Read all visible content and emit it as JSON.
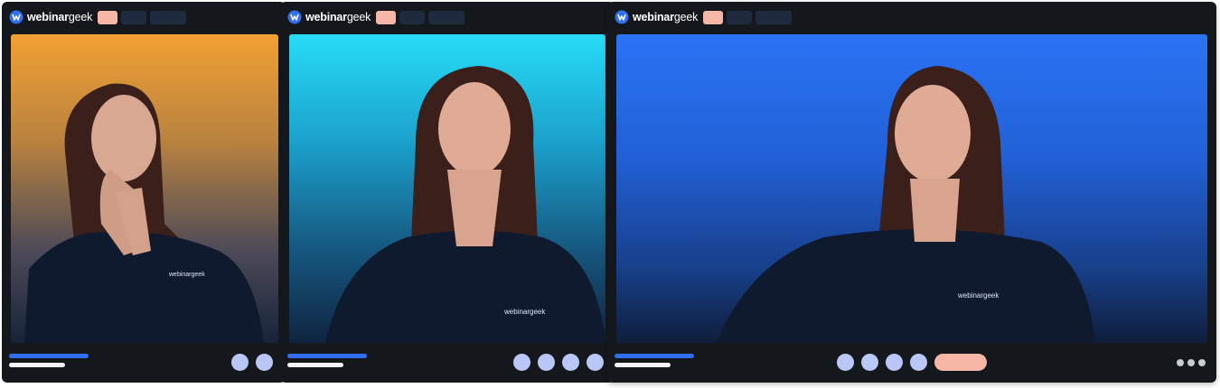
{
  "brand": {
    "name_bold": "webinar",
    "name_light": "geek",
    "accent": "#f6b7a6",
    "primary": "#2f6ff0"
  },
  "panels": [
    {
      "id": "panel-1",
      "controls": 2,
      "shirt_logo": "webinargeek"
    },
    {
      "id": "panel-2",
      "controls": 4,
      "shirt_logo": "webinargeek"
    },
    {
      "id": "panel-3",
      "controls": 4,
      "has_cta": true,
      "has_more": true,
      "shirt_logo": "webinargeek"
    }
  ],
  "icons": {
    "logo": "webinargeek-logo-icon",
    "more": "more-dots-icon"
  }
}
